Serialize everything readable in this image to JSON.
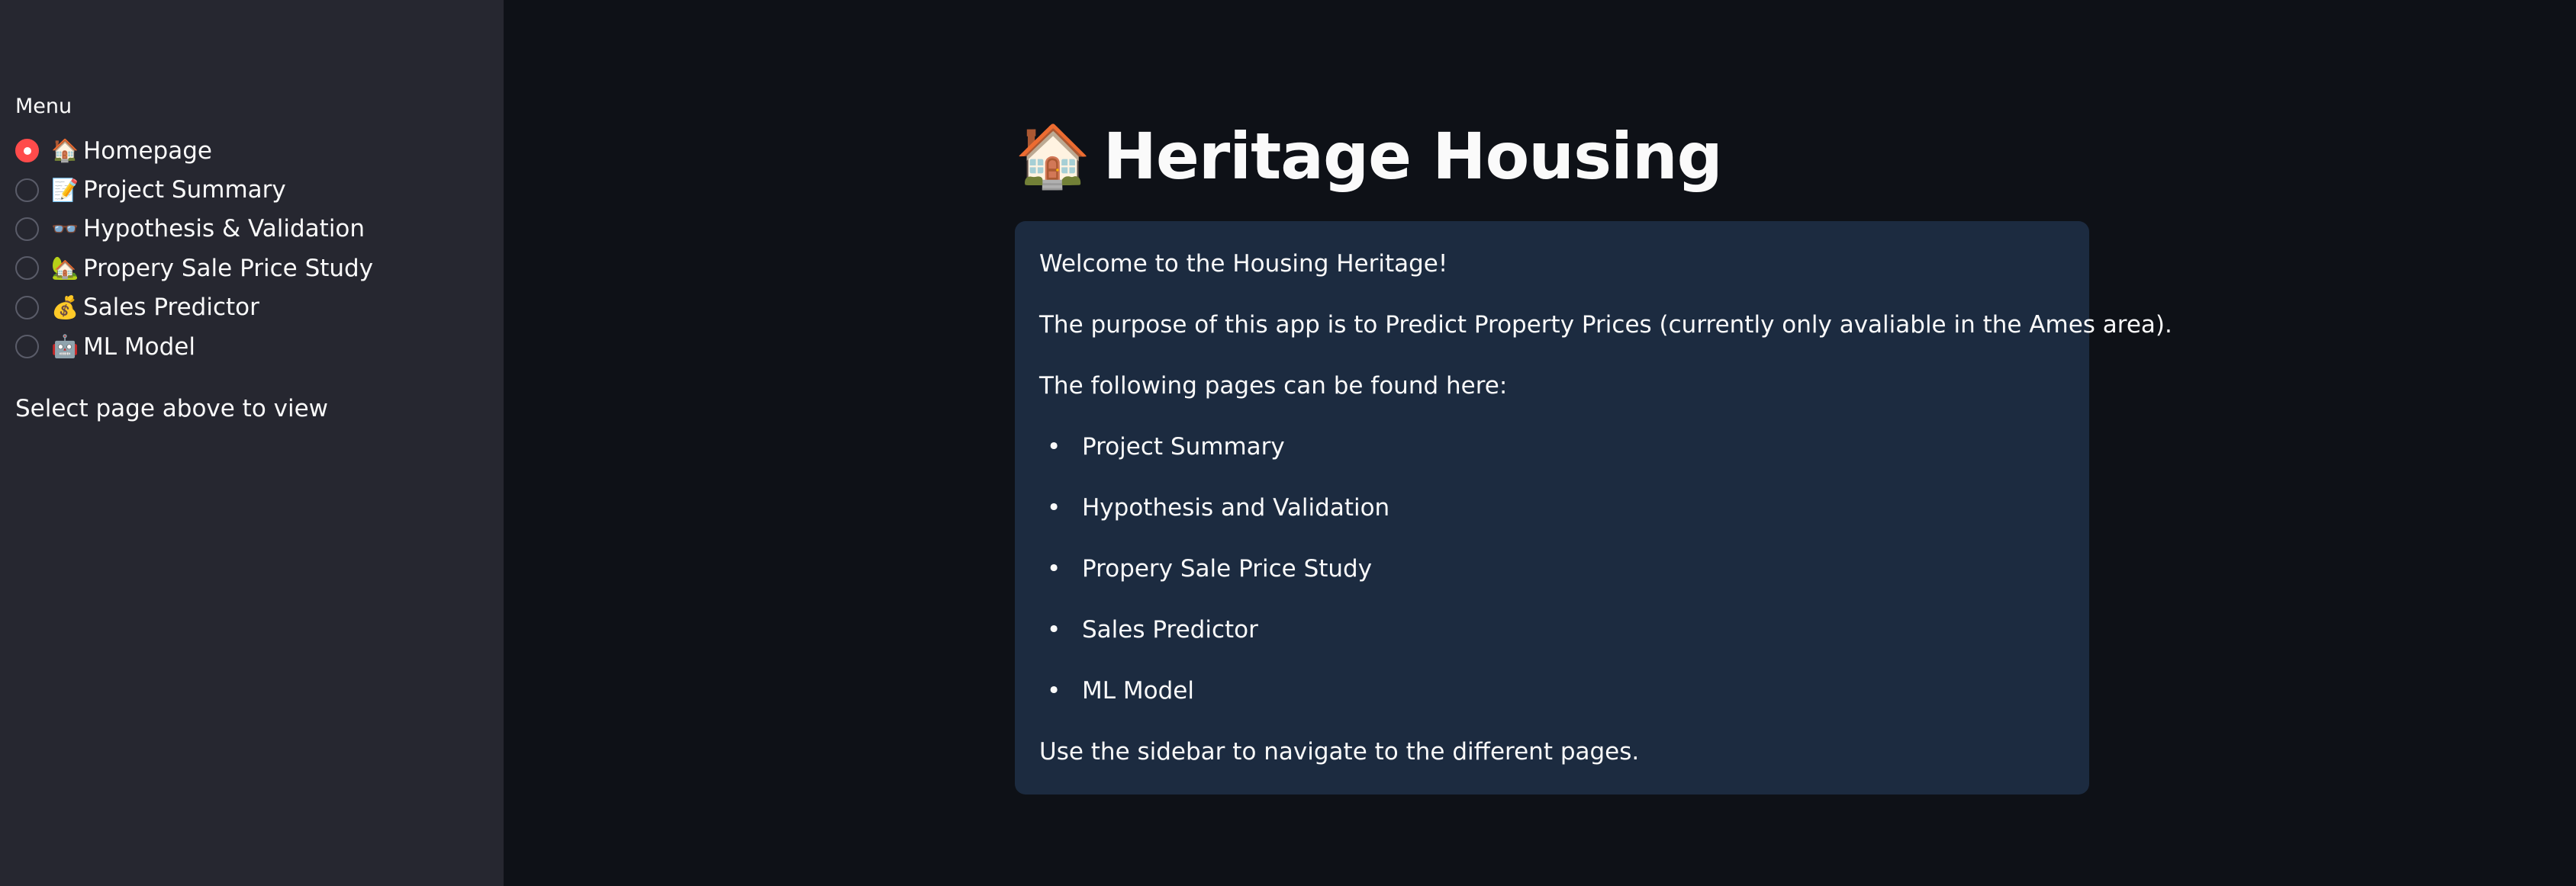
{
  "sidebar": {
    "menu_label": "Menu",
    "items": [
      {
        "emoji": "🏠",
        "icon": "house-icon",
        "label": "Homepage",
        "selected": true
      },
      {
        "emoji": "📝",
        "icon": "memo-icon",
        "label": "Project Summary",
        "selected": false
      },
      {
        "emoji": "👓",
        "icon": "glasses-icon",
        "label": "Hypothesis & Validation",
        "selected": false
      },
      {
        "emoji": "🏡",
        "icon": "house-garden-icon",
        "label": "Propery Sale Price Study",
        "selected": false
      },
      {
        "emoji": "💰",
        "icon": "money-bag-icon",
        "label": "Sales Predictor",
        "selected": false
      },
      {
        "emoji": "🤖",
        "icon": "robot-icon",
        "label": "ML Model",
        "selected": false
      }
    ],
    "hint": "Select page above to view"
  },
  "main": {
    "title_emoji": "🏠",
    "title": "Heritage Housing",
    "info": {
      "welcome": "Welcome to the Housing Heritage!",
      "purpose": "The purpose of this app is to Predict Property Prices (currently only avaliable in the Ames area).",
      "pages_intro": "The following pages can be found here:",
      "pages": [
        "Project Summary",
        "Hypothesis and Validation",
        "Propery Sale Price Study",
        "Sales Predictor",
        "ML Model"
      ],
      "footer": "Use the sidebar to navigate to the different pages."
    }
  },
  "colors": {
    "background": "#0e1117",
    "sidebar": "#262730",
    "info_box": "#1c2b40",
    "accent": "#ff4b4b",
    "text": "#fafafa"
  }
}
